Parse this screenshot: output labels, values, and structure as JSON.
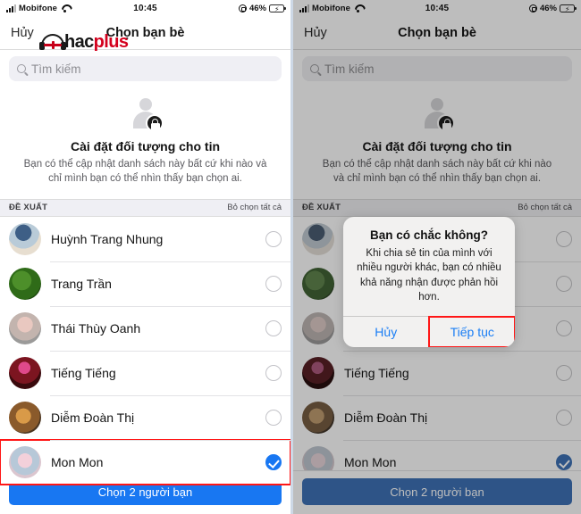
{
  "status_bar": {
    "carrier": "Mobifone",
    "time": "10:45",
    "battery_percent": "46%",
    "icons": [
      "signal-bars-icon",
      "wifi-icon",
      "rotation-lock-icon",
      "battery-charging-icon"
    ]
  },
  "nav": {
    "cancel_label": "Hủy",
    "title": "Chọn bạn bè"
  },
  "watermark": {
    "text_dark": "hac",
    "text_red": "plus",
    "accent": "#d4001d"
  },
  "search": {
    "placeholder": "Tìm kiếm"
  },
  "hero": {
    "title": "Cài đặt đối tượng cho tin",
    "subtitle": "Bạn có thể cập nhật danh sách này bất cứ khi nào và chỉ mình bạn có thể nhìn thấy bạn chọn ai."
  },
  "section": {
    "title": "ĐỀ XUẤT",
    "action": "Bỏ chọn tất cả"
  },
  "friends": [
    {
      "name": "Huỳnh Trang Nhung",
      "selected": false,
      "avatar_class": "av1"
    },
    {
      "name": "Trang Trần",
      "selected": false,
      "avatar_class": "av2"
    },
    {
      "name": "Thái Thùy Oanh",
      "selected": false,
      "avatar_class": "av3"
    },
    {
      "name": "Tiếng Tiếng",
      "selected": false,
      "avatar_class": "av4"
    },
    {
      "name": "Diễm Đoàn Thị",
      "selected": false,
      "avatar_class": "av5"
    },
    {
      "name": "Mon Mon",
      "selected": true,
      "avatar_class": "av6"
    }
  ],
  "cta": {
    "label": "Chọn 2 người bạn",
    "color": "#1877f2"
  },
  "alert": {
    "title": "Bạn có chắc không?",
    "message": "Khi chia sẻ tin của mình với nhiều người khác, bạn có nhiều khả năng nhận được phản hồi hơn.",
    "cancel_label": "Hủy",
    "confirm_label": "Tiếp tục",
    "confirm_highlight_color": "#ff1616"
  },
  "annotations": {
    "left_highlight_row_index": 5,
    "highlight_color": "#ff1616"
  }
}
